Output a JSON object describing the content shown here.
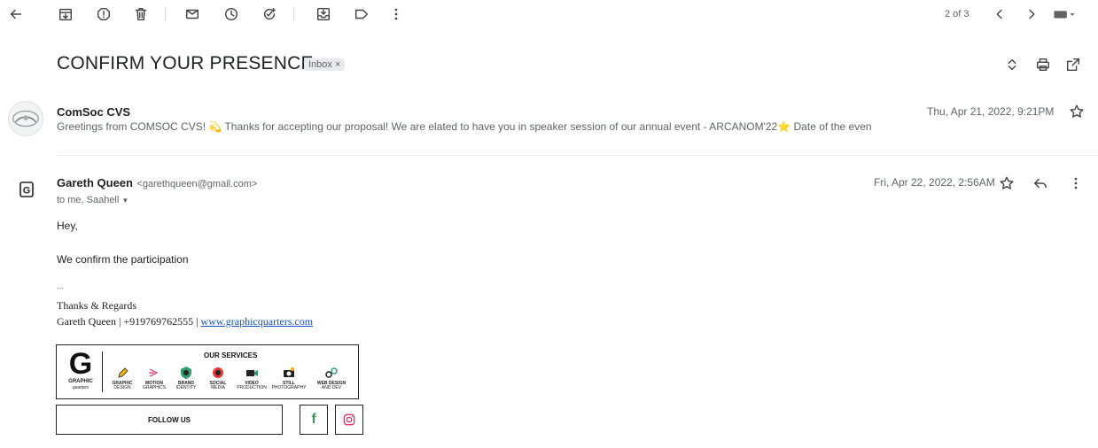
{
  "toolbar": {
    "pagination": "2 of 3"
  },
  "thread": {
    "subject": "CONFIRM YOUR PRESENCE",
    "label_chip": "Inbox ×"
  },
  "message1": {
    "sender": "ComSoc CVS",
    "date": "Thu, Apr 21, 2022, 9:21PM",
    "snippet_a": "Greetings from COMSOC CVS!",
    "snippet_b": "Thanks for accepting our proposal! We are elated to have you in speaker session of our annual event - ARCANOM'22",
    "snippet_c": "Date of the even"
  },
  "message2": {
    "sender": "Gareth Queen",
    "sender_email": "<garethqueen@gmail.com>",
    "date": "Fri, Apr 22, 2022, 2:56AM",
    "recipients": "to me, Saahell",
    "avatar_letter": "G",
    "greeting": "Hey,",
    "body": "We confirm the participation",
    "ellipsis": "...",
    "sign_thanks": "Thanks & Regards",
    "sign_name_phone": "Gareth Queen | +919769762555 |",
    "sign_link": "www.graphicquarters.com"
  },
  "signature_card": {
    "logo_letter": "G",
    "logo_caption_a": "GRAPHIC",
    "logo_caption_b": "quarters",
    "services_title": "OUR SERVICES",
    "services": [
      {
        "line1": "GRAPHIC",
        "line2": "DESIGN"
      },
      {
        "line1": "MOTION",
        "line2": "GRAPHICS"
      },
      {
        "line1": "BRAND",
        "line2": "IDENTITY"
      },
      {
        "line1": "SOCIAL",
        "line2": "MEDIA"
      },
      {
        "line1": "VIDEO",
        "line2": "PRODUCTION"
      },
      {
        "line1": "STILL",
        "line2": "PHOTOGRAPHY"
      },
      {
        "line1": "WEB DESIGN",
        "line2": "AND DEV"
      }
    ],
    "follow_label": "FOLLOW US",
    "facebook_glyph": "f"
  },
  "colors": {
    "facebook": "#3b9a57",
    "instagram": "#e1306c",
    "link": "#1155cc",
    "star_yellow": "#f4b400"
  }
}
